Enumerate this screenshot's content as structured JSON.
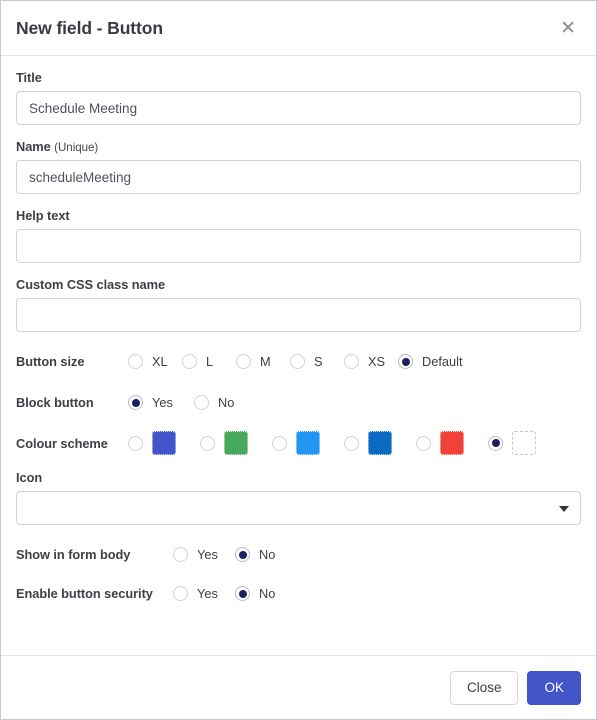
{
  "dialog": {
    "title": "New field - Button",
    "close_icon": "close-icon"
  },
  "fields": {
    "title": {
      "label": "Title",
      "value": "Schedule Meeting",
      "placeholder": ""
    },
    "name": {
      "label": "Name",
      "label_suffix": "(Unique)",
      "value": "scheduleMeeting",
      "placeholder": ""
    },
    "help_text": {
      "label": "Help text",
      "value": "",
      "placeholder": ""
    },
    "custom_css": {
      "label": "Custom CSS class name",
      "value": "",
      "placeholder": ""
    },
    "icon": {
      "label": "Icon",
      "value": "",
      "caret_icon": "chevron-down-icon"
    }
  },
  "button_size": {
    "label": "Button size",
    "options": [
      {
        "label": "XL",
        "selected": false
      },
      {
        "label": "L",
        "selected": false
      },
      {
        "label": "M",
        "selected": false
      },
      {
        "label": "S",
        "selected": false
      },
      {
        "label": "XS",
        "selected": false
      },
      {
        "label": "Default",
        "selected": true
      }
    ]
  },
  "block_button": {
    "label": "Block button",
    "options": [
      {
        "label": "Yes",
        "selected": true
      },
      {
        "label": "No",
        "selected": false
      }
    ]
  },
  "colour_scheme": {
    "label": "Colour scheme",
    "options": [
      {
        "color": "#4154c8",
        "selected": false
      },
      {
        "color": "#45a85a",
        "selected": false
      },
      {
        "color": "#2196f3",
        "selected": false
      },
      {
        "color": "#0b6bc2",
        "selected": false
      },
      {
        "color": "#f0413a",
        "selected": false
      },
      {
        "color": "#ffffff",
        "selected": true
      }
    ]
  },
  "show_in_form_body": {
    "label": "Show in form body",
    "options": [
      {
        "label": "Yes",
        "selected": false
      },
      {
        "label": "No",
        "selected": true
      }
    ]
  },
  "enable_button_security": {
    "label": "Enable button security",
    "options": [
      {
        "label": "Yes",
        "selected": false
      },
      {
        "label": "No",
        "selected": true
      }
    ]
  },
  "footer": {
    "close_label": "Close",
    "ok_label": "OK"
  }
}
